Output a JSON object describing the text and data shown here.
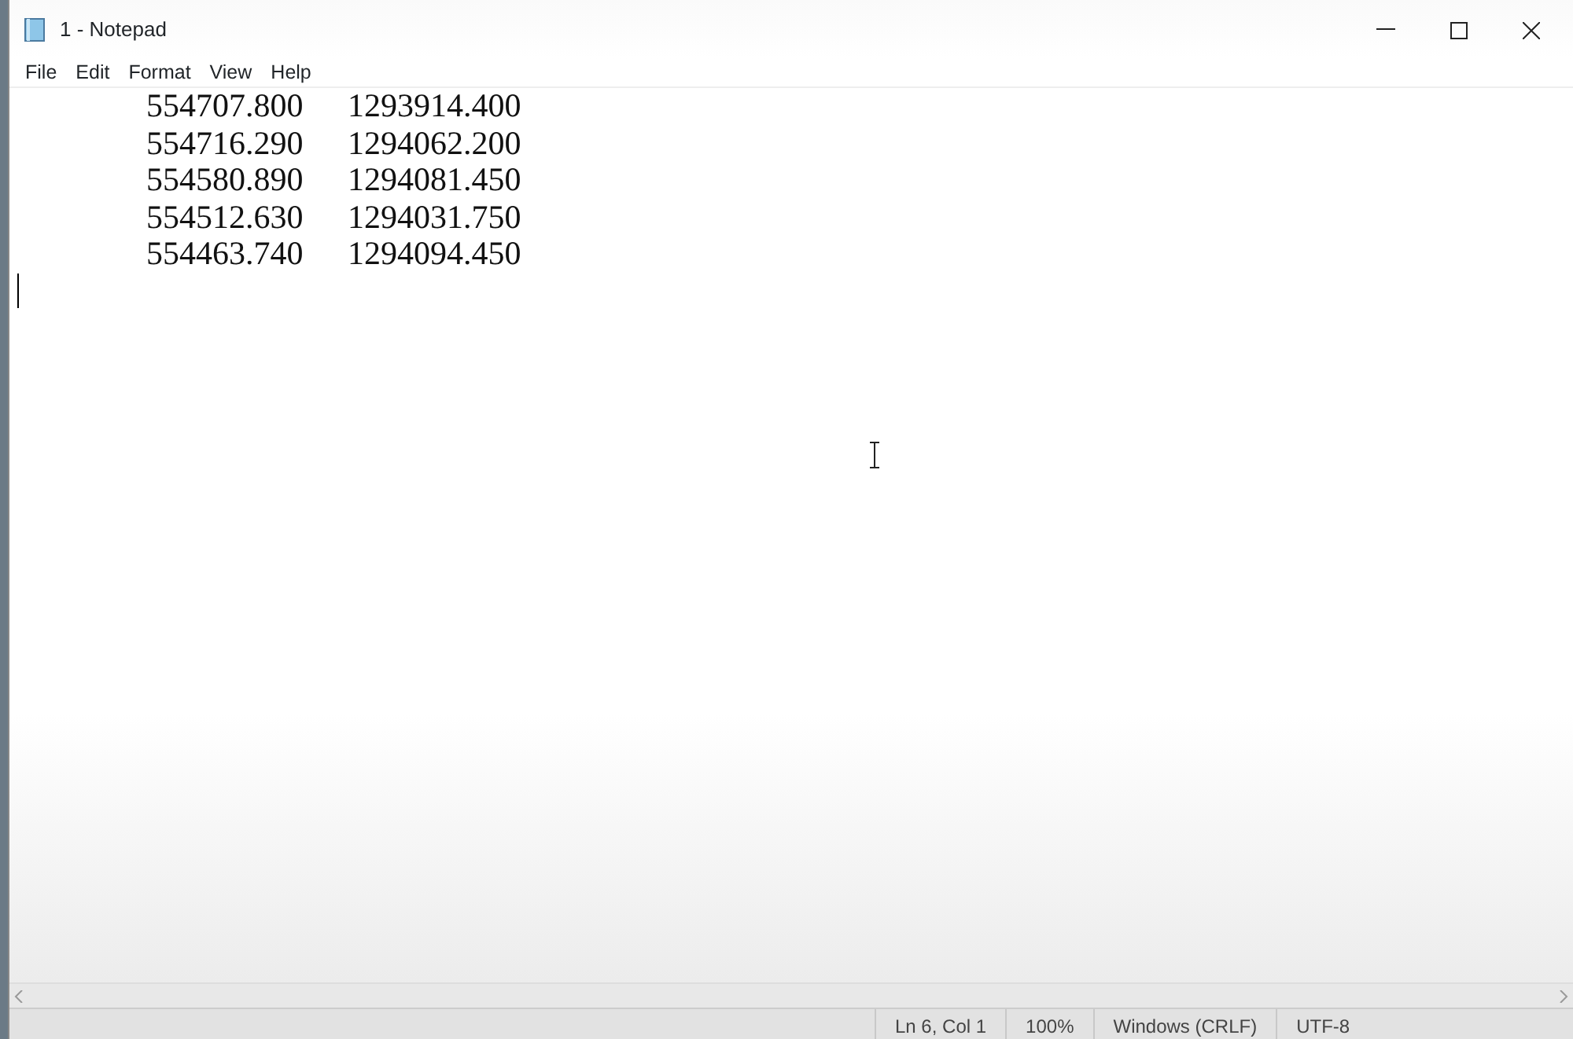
{
  "window": {
    "title": "1 - Notepad"
  },
  "menu": [
    "File",
    "Edit",
    "Format",
    "View",
    "Help"
  ],
  "editor": {
    "lines": [
      {
        "cells": [
          "554707.800",
          "1293914.400"
        ]
      },
      {
        "cells": [
          "554716.290",
          "1294062.200"
        ]
      },
      {
        "cells": [
          "554580.890",
          "1294081.450"
        ]
      },
      {
        "cells": [
          "554512.630",
          "1294031.750"
        ]
      },
      {
        "cells": [
          "554463.740",
          "1294094.450"
        ]
      }
    ]
  },
  "status_bar": [
    "Ln 6, Col 1",
    "100%",
    "Windows (CRLF)",
    "UTF-8"
  ]
}
